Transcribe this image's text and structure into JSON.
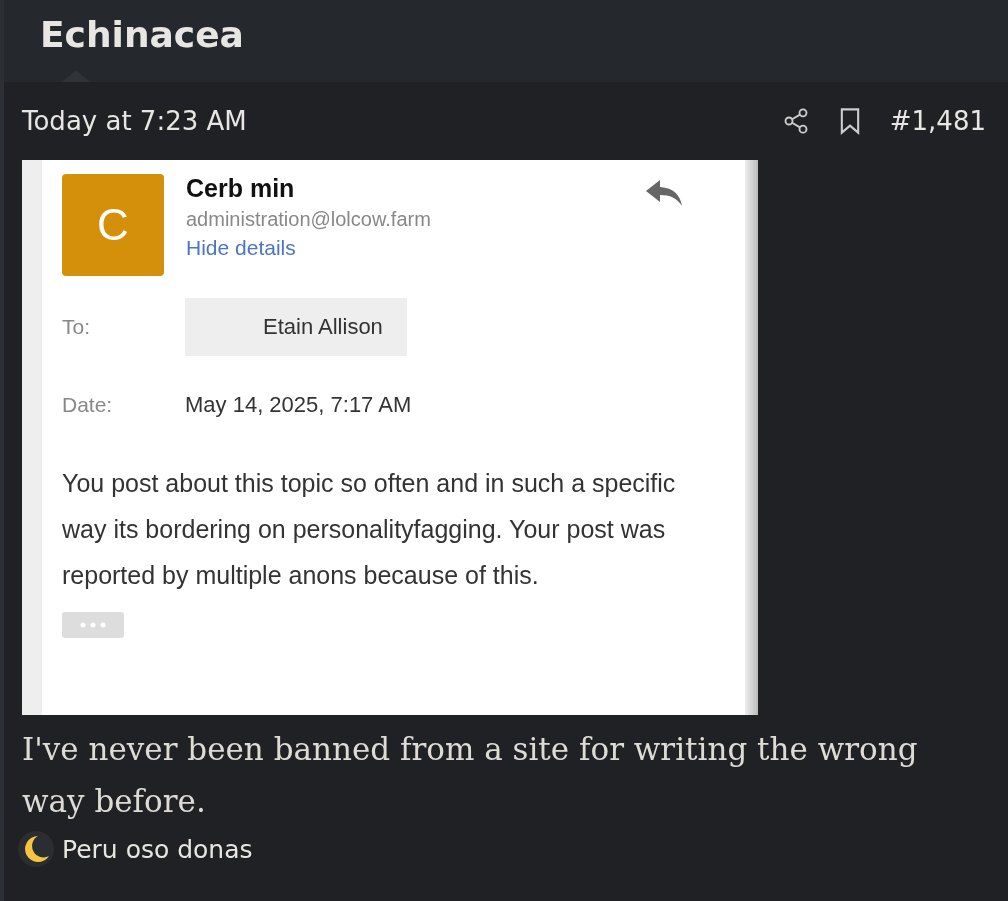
{
  "thread": {
    "title": "Echinacea"
  },
  "post": {
    "time": "Today at 7:23 AM",
    "number": "#1,481",
    "email": {
      "avatar_letter": "C",
      "sender_name": "Cerb min",
      "sender_address": "administration@lolcow.farm",
      "details_link": "Hide details",
      "to_label": "To:",
      "to_value": "Etain Allison",
      "date_label": "Date:",
      "date_value": "May 14, 2025, 7:17 AM",
      "message": "You post about this topic so often and in such a specific way its bordering on personalityfagging. Your post was reported by multiple anons because of this."
    },
    "body": "I've never been banned from a site for writing the wrong way before.",
    "reaction": {
      "user": "Peru oso donas"
    }
  }
}
